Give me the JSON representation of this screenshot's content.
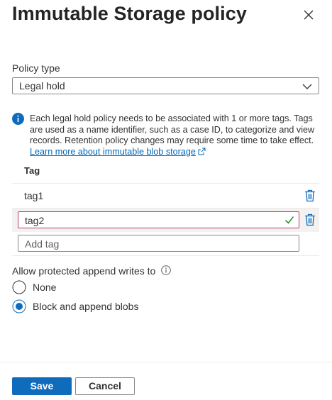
{
  "panel": {
    "title": "Immutable Storage policy"
  },
  "policy": {
    "type_label": "Policy type",
    "type_value": "Legal hold"
  },
  "info": {
    "text": "Each legal hold policy needs to be associated with 1 or more tags. Tags are used as a name identifier, such as a case ID, to categorize and view records. Retention policy changes may require some time to take effect.",
    "link": "Learn more about immutable blob storage"
  },
  "tags": {
    "header": "Tag",
    "items": [
      "tag1",
      "tag2"
    ],
    "add_placeholder": "Add tag"
  },
  "append": {
    "label": "Allow protected append writes to",
    "options": [
      "None",
      "Block and append blobs"
    ],
    "selected": "Block and append blobs"
  },
  "footer": {
    "save_label": "Save",
    "cancel_label": "Cancel"
  },
  "colors": {
    "accent": "#0f6cbd",
    "link": "#0067b8",
    "active_border": "#b93a72",
    "success": "#107c10"
  },
  "icons": [
    "close-icon",
    "chevron-down-icon",
    "info-icon",
    "external-link-icon",
    "trash-icon",
    "checkmark-icon"
  ]
}
